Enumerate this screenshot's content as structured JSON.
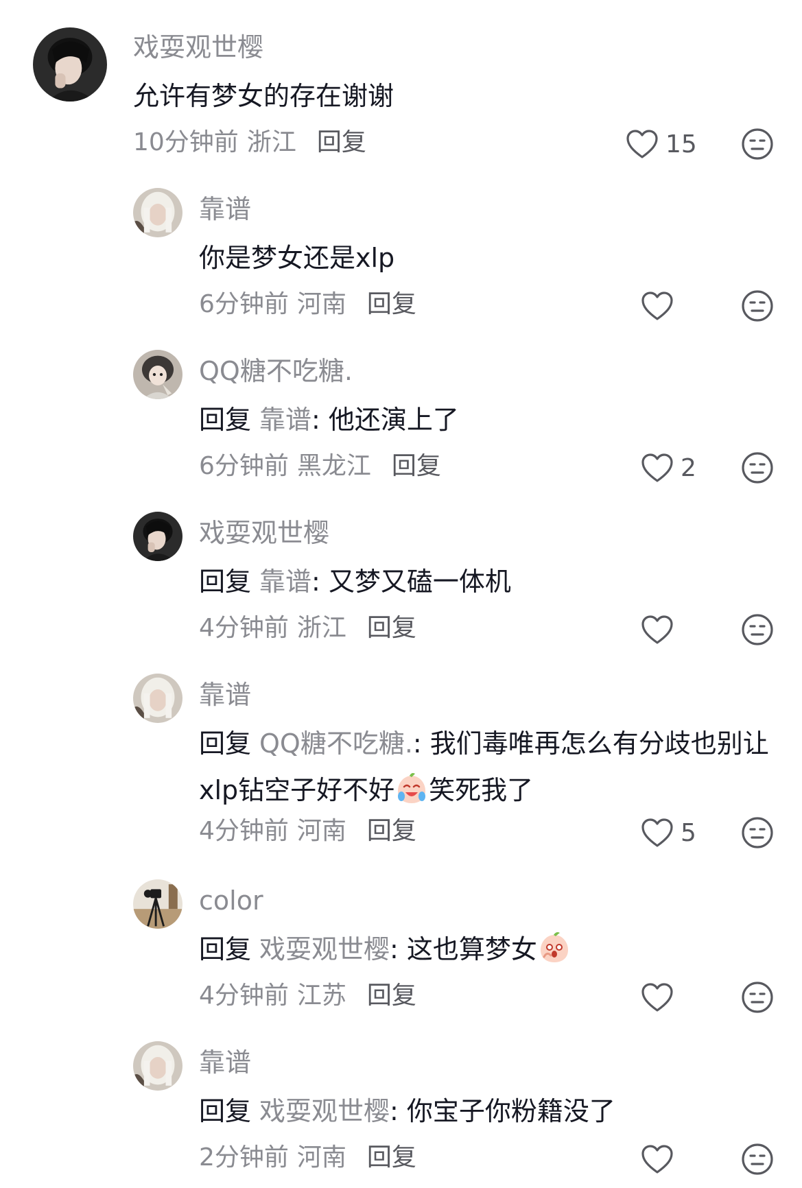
{
  "comments": [
    {
      "username": "戏耍观世樱",
      "text": "允许有梦女的存在谢谢",
      "time": "10分钟前",
      "location": "浙江",
      "reply_label": "回复",
      "likes": "15",
      "avatar": "dark-hair-person"
    },
    {
      "username": "靠谱",
      "text": "你是梦女还是xlp",
      "time": "6分钟前",
      "location": "河南",
      "reply_label": "回复",
      "likes": "",
      "avatar": "white-hair-person"
    },
    {
      "username": "QQ糖不吃糖.",
      "reply_prefix": "回复",
      "mention": "靠谱",
      "text": ": 他还演上了",
      "time": "6分钟前",
      "location": "黑龙江",
      "reply_label": "回复",
      "likes": "2",
      "avatar": "anime-girl"
    },
    {
      "username": "戏耍观世樱",
      "reply_prefix": "回复",
      "mention": "靠谱",
      "text": ": 又梦又磕一体机",
      "time": "4分钟前",
      "location": "浙江",
      "reply_label": "回复",
      "likes": "",
      "avatar": "dark-hair-person"
    },
    {
      "username": "靠谱",
      "reply_prefix": "回复",
      "mention": "QQ糖不吃糖.",
      "text": ": 我们毒唯再怎么有分歧也别让xlp钻空子好不好",
      "text_after_emoji": "笑死我了",
      "emoji": "crying-laughing-peach-emoji",
      "time": "4分钟前",
      "location": "河南",
      "reply_label": "回复",
      "likes": "5",
      "avatar": "white-hair-person"
    },
    {
      "username": "color",
      "reply_prefix": "回复",
      "mention": "戏耍观世樱",
      "text": ": 这也算梦女",
      "emoji": "shocked-peach-emoji",
      "time": "4分钟前",
      "location": "江苏",
      "reply_label": "回复",
      "likes": "",
      "avatar": "camera-tripod"
    },
    {
      "username": "靠谱",
      "reply_prefix": "回复",
      "mention": "戏耍观世樱",
      "text": ": 你宝子你粉籍没了",
      "time": "2分钟前",
      "location": "河南",
      "reply_label": "回复",
      "likes": "",
      "avatar": "white-hair-person"
    }
  ],
  "icons": {
    "like": "heart-outline-icon",
    "dislike": "meh-face-icon"
  },
  "colors": {
    "text": "#161823",
    "secondary": "#8a8b91",
    "action": "#58595f",
    "background": "#ffffff"
  }
}
